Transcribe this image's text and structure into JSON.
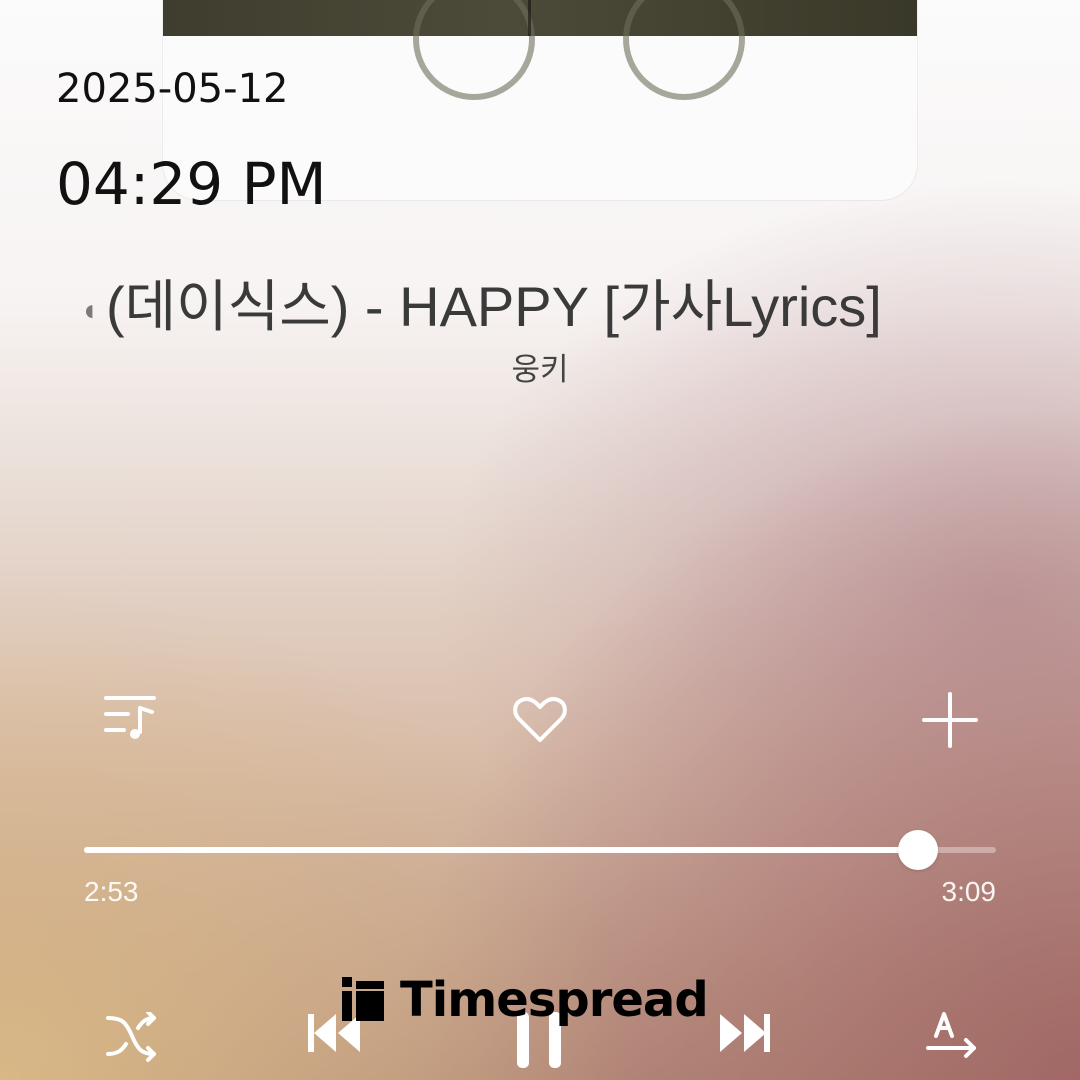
{
  "overlay": {
    "date": "2025-05-12",
    "time": "04:29 PM"
  },
  "track": {
    "title": "(데이식스) - HAPPY [가사Lyrics]",
    "artist": "웅키"
  },
  "actions": {
    "playlist_icon": "playlist-music-icon",
    "like_icon": "heart-outline-icon",
    "add_icon": "plus-icon"
  },
  "playback": {
    "elapsed": "2:53",
    "duration": "3:09",
    "progress": 0.915
  },
  "controls": {
    "shuffle_icon": "shuffle-icon",
    "previous_icon": "skip-previous-icon",
    "play_pause_icon": "pause-icon",
    "next_icon": "skip-next-icon",
    "translate_icon": "translate-lyrics-icon"
  },
  "watermark": {
    "text": "Timespread"
  },
  "colors": {
    "date_time_text": "#111111",
    "title_text": "#3a3a3a",
    "icon": "#ffffff",
    "progress_fill": "#ffffff",
    "watermark": "#000000"
  }
}
